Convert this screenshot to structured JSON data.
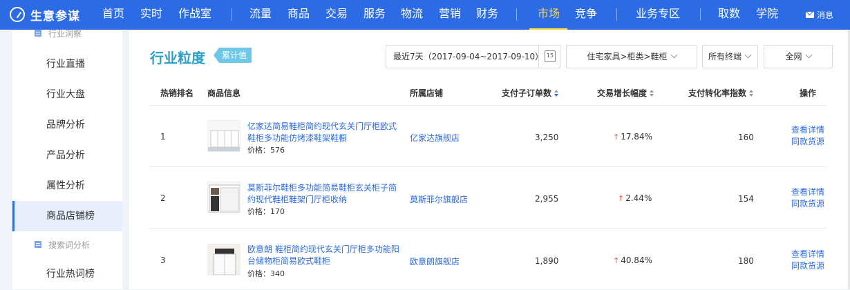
{
  "nav": {
    "logo_text": "生意参谋",
    "items": [
      {
        "label": "首页"
      },
      {
        "label": "实时"
      },
      {
        "label": "作战室"
      },
      {
        "label": "流量"
      },
      {
        "label": "商品"
      },
      {
        "label": "交易"
      },
      {
        "label": "服务"
      },
      {
        "label": "物流"
      },
      {
        "label": "营销"
      },
      {
        "label": "财务"
      },
      {
        "label": "市场"
      },
      {
        "label": "竞争"
      },
      {
        "label": "业务专区"
      },
      {
        "label": "取数"
      },
      {
        "label": "学院"
      }
    ],
    "active": "市场",
    "message_label": "消息",
    "accent_color": "#ffd84a",
    "bg_color": "#2c6be6"
  },
  "sidebar": {
    "group_top": "行业洞察",
    "items": [
      {
        "label": "行业直播"
      },
      {
        "label": "行业大盘"
      },
      {
        "label": "品牌分析"
      },
      {
        "label": "产品分析"
      },
      {
        "label": "属性分析"
      },
      {
        "label": "商品店铺榜"
      }
    ],
    "active_item": "商品店铺榜",
    "group_search": "搜索词分析",
    "item_after": "行业热词榜"
  },
  "header": {
    "title": "行业粒度",
    "tag": "累计值",
    "date_range": "最近7天（2017-09-04~2017-09-10）",
    "calendar_day": "15",
    "category": "住宅家具>柜类>鞋柜",
    "terminal": "所有终端",
    "channel": "全网"
  },
  "table": {
    "columns": {
      "rank": "热销排名",
      "product": "商品信息",
      "shop": "所属店铺",
      "orders": "支付子订单数",
      "growth": "交易增长幅度",
      "conversion": "支付转化率指数",
      "action": "操作"
    },
    "rows": [
      {
        "rank": "1",
        "name": "亿家达简易鞋柜简约现代玄关门厅柜欧式鞋柜多功能仿烤漆鞋架鞋橱",
        "price": "价格：576",
        "shop": "亿家达旗舰店",
        "orders": "3,250",
        "growth": "17.84%",
        "conversion": "160",
        "action1": "查看详情",
        "action2": "同款货源"
      },
      {
        "rank": "2",
        "name": "莫斯菲尔鞋柜多功能简易鞋柜玄关柜子简约现代鞋柜鞋架门厅柜收纳",
        "price": "价格：170",
        "shop": "莫斯菲尔旗舰店",
        "orders": "2,955",
        "growth": "2.44%",
        "conversion": "154",
        "action1": "查看详情",
        "action2": "同款货源"
      },
      {
        "rank": "3",
        "name": "欧意朗 鞋柜简约现代玄关门厅柜多功能阳台储物柜简易欧式鞋柜",
        "price": "价格：340",
        "shop": "欧意朗旗舰店",
        "orders": "1,890",
        "growth": "40.84%",
        "conversion": "180",
        "action1": "查看详情",
        "action2": "同款货源"
      }
    ]
  }
}
